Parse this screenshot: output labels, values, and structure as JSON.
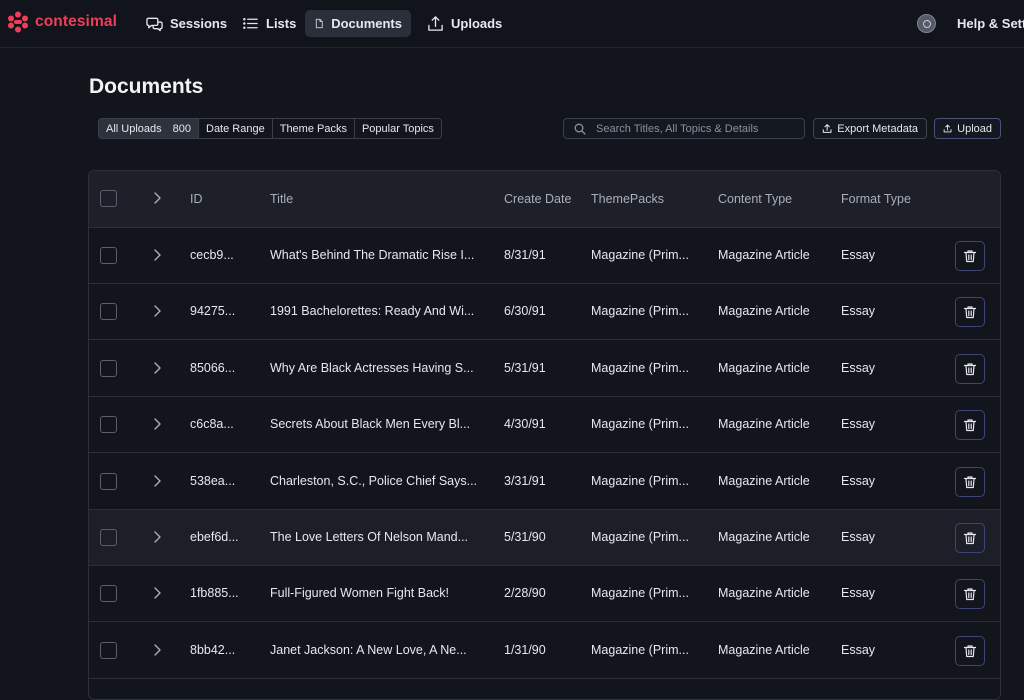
{
  "app": {
    "brand": "contesimal",
    "accent": "#ef3e59"
  },
  "nav": {
    "sessions": "Sessions",
    "lists": "Lists",
    "documents": "Documents",
    "uploads": "Uploads",
    "help": "Help & Setti"
  },
  "page": {
    "title": "Documents"
  },
  "filters": {
    "all_uploads": "All Uploads",
    "all_uploads_count": "800",
    "date_range": "Date Range",
    "theme_packs": "Theme Packs",
    "popular_topics": "Popular Topics"
  },
  "search": {
    "placeholder": "Search Titles, All Topics & Details"
  },
  "actions": {
    "export": "Export Metadata",
    "upload": "Upload"
  },
  "table": {
    "headers": {
      "id": "ID",
      "title": "Title",
      "create_date": "Create Date",
      "themepacks": "ThemePacks",
      "content_type": "Content Type",
      "format_type": "Format Type"
    },
    "rows": [
      {
        "id": "cecb9...",
        "title": "What's Behind The Dramatic Rise I...",
        "date": "8/31/91",
        "themepacks": "Magazine (Prim...",
        "content_type": "Magazine Article",
        "format_type": "Essay"
      },
      {
        "id": "94275...",
        "title": "1991 Bachelorettes: Ready And Wi...",
        "date": "6/30/91",
        "themepacks": "Magazine (Prim...",
        "content_type": "Magazine Article",
        "format_type": "Essay"
      },
      {
        "id": "85066...",
        "title": "Why Are Black Actresses Having S...",
        "date": "5/31/91",
        "themepacks": "Magazine (Prim...",
        "content_type": "Magazine Article",
        "format_type": "Essay"
      },
      {
        "id": "c6c8a...",
        "title": "Secrets About Black Men Every Bl...",
        "date": "4/30/91",
        "themepacks": "Magazine (Prim...",
        "content_type": "Magazine Article",
        "format_type": "Essay"
      },
      {
        "id": "538ea...",
        "title": "Charleston, S.C., Police Chief Says...",
        "date": "3/31/91",
        "themepacks": "Magazine (Prim...",
        "content_type": "Magazine Article",
        "format_type": "Essay"
      },
      {
        "id": "ebef6d...",
        "title": "The Love Letters Of Nelson Mand...",
        "date": "5/31/90",
        "themepacks": "Magazine (Prim...",
        "content_type": "Magazine Article",
        "format_type": "Essay"
      },
      {
        "id": "1fb885...",
        "title": "Full-Figured Women Fight Back!",
        "date": "2/28/90",
        "themepacks": "Magazine (Prim...",
        "content_type": "Magazine Article",
        "format_type": "Essay"
      },
      {
        "id": "8bb42...",
        "title": "Janet Jackson: A New Love, A Ne...",
        "date": "1/31/90",
        "themepacks": "Magazine (Prim...",
        "content_type": "Magazine Article",
        "format_type": "Essay"
      }
    ]
  }
}
